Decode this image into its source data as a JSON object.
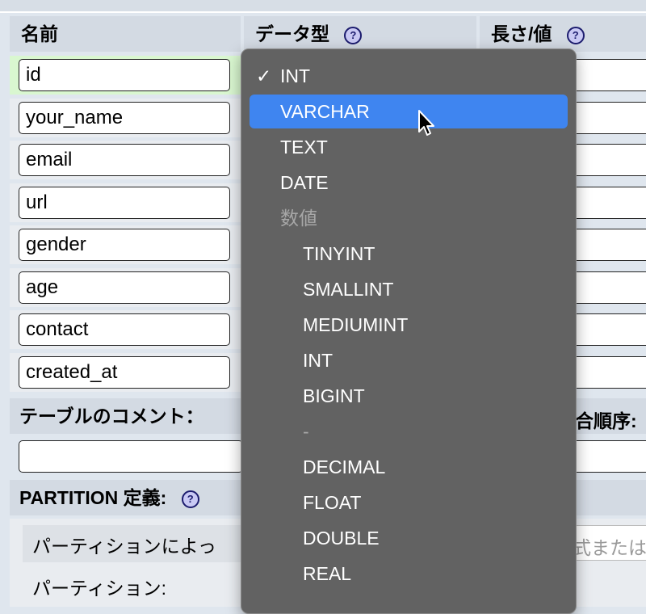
{
  "header": {
    "name_col": "名前",
    "type_col": "データ型",
    "length_col": "長さ/値",
    "help_icon_glyph": "?"
  },
  "fields": [
    {
      "name": "id"
    },
    {
      "name": "your_name"
    },
    {
      "name": "email"
    },
    {
      "name": "url"
    },
    {
      "name": "gender"
    },
    {
      "name": "age"
    },
    {
      "name": "contact"
    },
    {
      "name": "created_at"
    }
  ],
  "table_comment": {
    "label": "テーブルのコメント：",
    "value": "",
    "collation_partial": "合順序:"
  },
  "partition": {
    "label": "PARTITION 定義:",
    "by_text": "パーティションによっ",
    "expr_partial": "式または",
    "count_label": "パーティション:"
  },
  "dropdown": {
    "checkmark": "✓",
    "selected_value": "INT",
    "options": [
      {
        "label": "INT",
        "kind": "item",
        "checked": true
      },
      {
        "label": "VARCHAR",
        "kind": "item",
        "highlighted": true
      },
      {
        "label": "TEXT",
        "kind": "item"
      },
      {
        "label": "DATE",
        "kind": "item"
      },
      {
        "label": "数値",
        "kind": "group"
      },
      {
        "label": "TINYINT",
        "kind": "sub"
      },
      {
        "label": "SMALLINT",
        "kind": "sub"
      },
      {
        "label": "MEDIUMINT",
        "kind": "sub"
      },
      {
        "label": "INT",
        "kind": "sub"
      },
      {
        "label": "BIGINT",
        "kind": "sub"
      },
      {
        "label": "-",
        "kind": "sep"
      },
      {
        "label": "DECIMAL",
        "kind": "sub"
      },
      {
        "label": "FLOAT",
        "kind": "sub"
      },
      {
        "label": "DOUBLE",
        "kind": "sub"
      },
      {
        "label": "REAL",
        "kind": "sub"
      }
    ]
  },
  "colors": {
    "highlight": "#3f85f0",
    "menu_bg": "#626262",
    "row_first_bg": "#d9f7d0"
  }
}
